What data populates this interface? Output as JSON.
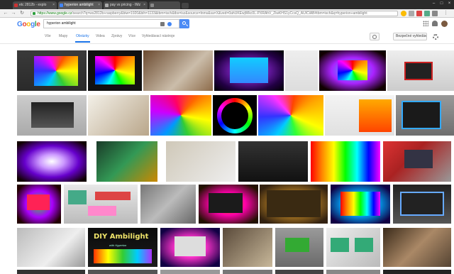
{
  "browser": {
    "tabs": [
      {
        "label": "etc 2812b - explo",
        "fav": "#c33",
        "active": false
      },
      {
        "label": "hyperion ambilight",
        "fav": "#4285f4",
        "active": true
      },
      {
        "label": "pay vs pricing - IMz",
        "fav": "#aaa",
        "active": false
      },
      {
        "label": "",
        "fav": "#888",
        "active": false
      }
    ],
    "url_host": "https://www.google.cz",
    "url_rest": "/search?q=ws2812b+raspberry&biw=1920&bih=1133&tbm=isch&tbs=isz&source=lnms&sa=X&ved=0ahUKEwjWkc0L-PXRAhV_ZiwKHS1yCcsQ_AUICiAB#tbm=isch&q=hyperion+ambilight"
  },
  "google": {
    "logo": [
      "G",
      "o",
      "o",
      "g",
      "l",
      "e"
    ],
    "logo_colors": [
      "#4285f4",
      "#ea4335",
      "#fbbc05",
      "#4285f4",
      "#34a853",
      "#ea4335"
    ],
    "search_value": "hyperion ambilight",
    "tabs": [
      {
        "label": "Vše"
      },
      {
        "label": "Mapy"
      },
      {
        "label": "Obrázky"
      },
      {
        "label": "Videa"
      },
      {
        "label": "Zprávy"
      },
      {
        "label": "Více"
      },
      {
        "label": "Vyhledávací nástroje"
      }
    ],
    "active_tab": "Obrázky",
    "safesearch_label": "Bezpečné vyhledávání ▾"
  },
  "thumb_text": {
    "diy_title": "DIY Ambilight",
    "diy_sub": "with Hyperion"
  },
  "thumbs": [
    {
      "fill": "linear-gradient(#3a3a3a,#2a2a2a)"
    },
    {
      "fill": "conic-gradient(from 0deg,#f00,#f80,#ff0,#0f0,#0ff,#00f,#f0f,#f00)"
    },
    {
      "fill": "radial-gradient(circle at 50% 50%,#ffffff 8%,#5ad 30%,#014 70%)"
    },
    {
      "fill": "linear-gradient(135deg,#6b4a2f,#cbbdaa 60%,#8d6b4a)"
    },
    {
      "fill": "radial-gradient(ellipse at center,#a3f 10%,#204 70%,#000)"
    },
    {
      "fill": "linear-gradient(#eee,#ddd)"
    },
    {
      "fill": "radial-gradient(ellipse at center,#3df 0%,#a2f 45%,#100 85%)"
    },
    {
      "fill": "linear-gradient(#eee,#ccc)"
    },
    {
      "fill": "linear-gradient(#ccc,#aaa)"
    },
    {
      "fill": "linear-gradient(#222,#555)"
    },
    {
      "fill": "linear-gradient(135deg,#f3f0e8,#b9a68a)"
    },
    {
      "fill": "conic-gradient(from 40deg,#f60,#ff0,#3c3,#09f,#c0f,#f06,#f60)"
    },
    {
      "fill": "radial-gradient(circle,#222 30%,#000 60%)"
    },
    {
      "fill": "conic-gradient(from 10deg,#f40,#fa0,#ff0,#3f3,#0cf,#33f,#f3f,#f40)"
    },
    {
      "fill": "linear-gradient(#f4f4f4,#e0e0e0)"
    },
    {
      "fill": "linear-gradient(#999,#6e6e6e)"
    },
    {
      "fill": "linear-gradient(#4c3c34,#2f2420)"
    },
    {
      "fill": "radial-gradient(ellipse at center,#fff 0%,#c9f 25%,#60c 55%,#100 90%)"
    },
    {
      "fill": "linear-gradient(135deg,#1a3a28,#395,#c80)"
    },
    {
      "fill": "linear-gradient(135deg,#cfc8b8,#eee)"
    },
    {
      "fill": "linear-gradient(#333,#111)"
    },
    {
      "fill": "linear-gradient(90deg,#f00,#f80,#ff0,#0f0,#0ff,#00f,#f0f)"
    },
    {
      "fill": "linear-gradient(135deg,#d33,#a22 40%,#999)"
    },
    {
      "fill": "radial-gradient(circle,#3d3 0%,#a0f 45%,#200 85%)"
    },
    {
      "fill": "linear-gradient(#e8e8e8,#bbb)"
    },
    {
      "fill": "linear-gradient(135deg,#777,#bbb 50%,#666)"
    },
    {
      "fill": "radial-gradient(ellipse at center,#f60 10%,#f0a 40%,#210 85%)"
    },
    {
      "fill": "radial-gradient(ellipse at center,#fd6 5%,#a72 40%,#321 85%)"
    },
    {
      "fill": "radial-gradient(ellipse at center,#ff5 5%,#0af 40%,#104 85%)"
    },
    {
      "fill": "linear-gradient(#222,#555)"
    },
    {
      "fill": "linear-gradient(135deg,#bbb,#eee 60%,#999)"
    },
    {
      "fill": "linear-gradient(#0b0b0b,#1c1c1c)"
    },
    {
      "fill": "radial-gradient(ellipse at center,#fff 5%,#f3c 35%,#104 85%)"
    },
    {
      "fill": "linear-gradient(135deg,#5a4a3a,#c8b89a)"
    },
    {
      "fill": "linear-gradient(#9a9a9a,#6a6a6a)"
    },
    {
      "fill": "linear-gradient(135deg,#eee,#bbb)"
    },
    {
      "fill": "linear-gradient(135deg,#3a2a1a,#a86 50%,#543)"
    }
  ]
}
